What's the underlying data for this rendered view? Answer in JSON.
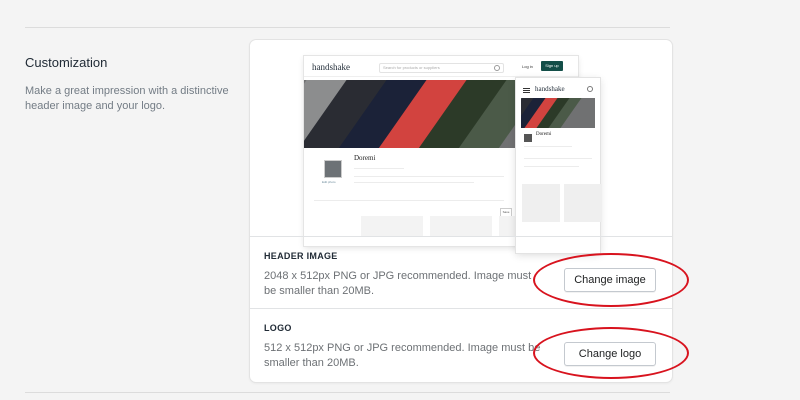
{
  "section": {
    "title": "Customization",
    "description": "Make a great impression with a distinctive header image and your logo."
  },
  "preview": {
    "brand": "handshake",
    "search_placeholder": "Search for products or suppliers",
    "login_label": "Log in",
    "signup_label": "Sign up",
    "store_name": "Doremi",
    "logo_caption": "Edit photo",
    "button_label": "Save",
    "accent_color": "#134e48",
    "fabric_colors": [
      "#8c8d8e",
      "#2a2c33",
      "#1b2238",
      "#d2433f",
      "#2c3a28",
      "#4b5a48",
      "#707172"
    ]
  },
  "header_image": {
    "label": "HEADER IMAGE",
    "description": "2048 x 512px PNG or JPG recommended. Image must be smaller than 20MB.",
    "button": "Change image"
  },
  "logo": {
    "label": "LOGO",
    "description": "512 x 512px PNG or JPG recommended. Image must be smaller than 20MB.",
    "button": "Change logo"
  },
  "annotation_color": "#d8131e"
}
